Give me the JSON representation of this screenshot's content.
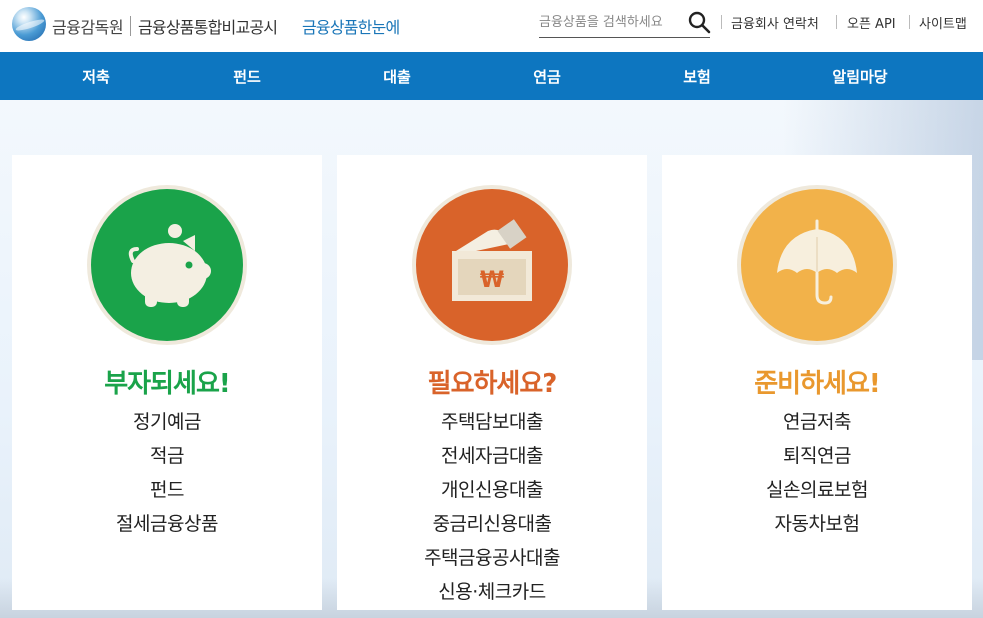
{
  "header": {
    "logo_fss": "금융감독원",
    "logo_main": "금융상품통합비교공시",
    "logo_sub": "금융상품한눈에",
    "search": {
      "placeholder": "금융상품을 검색하세요",
      "value": ""
    },
    "utility_links": [
      "금융회사 연락처",
      "오픈 API",
      "사이트맵"
    ]
  },
  "nav": {
    "items": [
      "저축",
      "펀드",
      "대출",
      "연금",
      "보험",
      "알림마당"
    ]
  },
  "cards": [
    {
      "title": "부자되세요!",
      "color": "#1aa34a",
      "icon": "piggy-bank-icon",
      "items": [
        "정기예금",
        "적금",
        "펀드",
        "절세금융상품"
      ]
    },
    {
      "title": "필요하세요?",
      "color": "#d9632a",
      "icon": "won-envelope-icon",
      "items": [
        "주택담보대출",
        "전세자금대출",
        "개인신용대출",
        "중금리신용대출",
        "주택금융공사대출",
        "신용·체크카드"
      ]
    },
    {
      "title": "준비하세요!",
      "color": "#e9982e",
      "icon": "umbrella-icon",
      "items": [
        "연금저축",
        "퇴직연금",
        "실손의료보험",
        "자동차보험"
      ]
    }
  ],
  "colors": {
    "nav_bg": "#0d76c0",
    "brand_blue": "#1a76b8",
    "green": "#1aa34a",
    "orange": "#d9632a",
    "yellow": "#f2b24a"
  }
}
